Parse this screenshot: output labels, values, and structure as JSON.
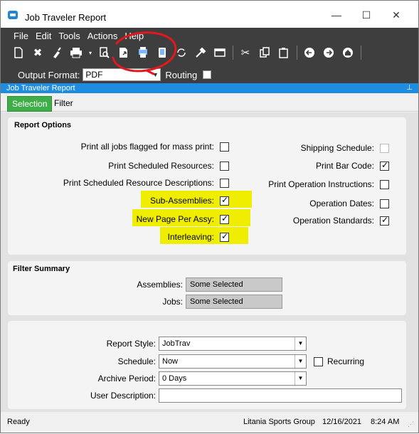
{
  "window": {
    "title": "Job Traveler Report",
    "controls": [
      "—",
      "☐",
      "✕"
    ]
  },
  "menu": [
    "File",
    "Edit",
    "Tools",
    "Actions",
    "Help"
  ],
  "toolbar": {
    "output_format_label": "Output Format:",
    "output_format_value": "PDF",
    "routing_label": "Routing"
  },
  "panel": {
    "title": "Job Traveler Report",
    "pin": "⊥"
  },
  "tabs": [
    "Selection",
    "Filter"
  ],
  "report_options": {
    "title": "Report Options",
    "left": [
      {
        "label": "Print all jobs flagged for mass print:",
        "checked": false
      },
      {
        "label": "Print Scheduled Resources:",
        "checked": false
      },
      {
        "label": "Print Scheduled Resource Descriptions:",
        "checked": false
      },
      {
        "label": "Sub-Assemblies:",
        "checked": true
      },
      {
        "label": "New Page Per Assy:",
        "checked": true
      },
      {
        "label": "Interleaving:",
        "checked": true
      }
    ],
    "right": [
      {
        "label": "Shipping Schedule:",
        "checked": false
      },
      {
        "label": "Print Bar Code:",
        "checked": true
      },
      {
        "label": "Print Operation Instructions:",
        "checked": false
      },
      {
        "label": "Operation Dates:",
        "checked": false
      },
      {
        "label": "Operation Standards:",
        "checked": true
      }
    ],
    "highlight_color": "#f0ee00"
  },
  "filter_summary": {
    "title": "Filter Summary",
    "assemblies_label": "Assemblies:",
    "assemblies_value": "Some Selected",
    "jobs_label": "Jobs:",
    "jobs_value": "Some Selected"
  },
  "report": {
    "style_label": "Report Style:",
    "style_value": "JobTrav",
    "schedule_label": "Schedule:",
    "schedule_value": "Now",
    "recurring_label": "Recurring",
    "archive_label": "Archive Period:",
    "archive_value": "0 Days",
    "user_desc_label": "User Description:",
    "user_desc_value": ""
  },
  "status": {
    "state": "Ready",
    "company": "Litania Sports Group",
    "date": "12/16/2021",
    "time": "8:24 AM"
  },
  "colors": {
    "accent": "#1e8ce0",
    "tab_active": "#3fae49",
    "annotation": "#e0191e"
  }
}
